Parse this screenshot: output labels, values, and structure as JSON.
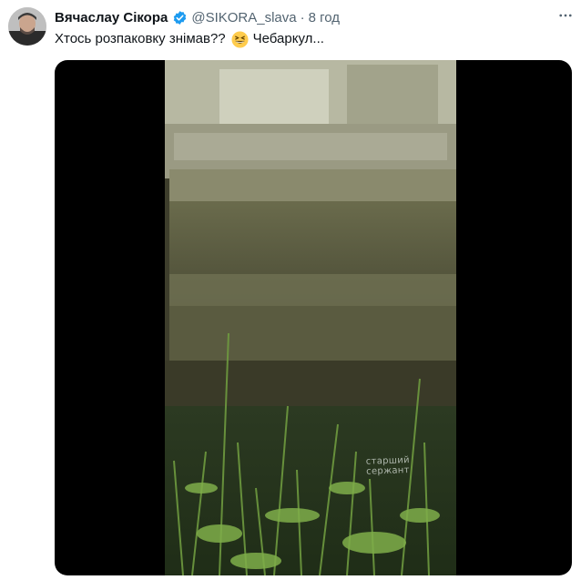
{
  "tweet": {
    "author_name": "Вячаслау Сікора",
    "handle": "@SIKORA_slava",
    "separator": "·",
    "time": "8 год",
    "text_before_emoji": "Хтось розпаковку знімав??",
    "emoji": "grinning-squinting-face-emoji",
    "text_after_emoji": "Чебаркул..."
  },
  "media": {
    "caption": "старший сержант",
    "type": "video"
  },
  "colors": {
    "verified": "#1d9bf0",
    "secondary_text": "#536471",
    "primary_text": "#0f1419"
  }
}
